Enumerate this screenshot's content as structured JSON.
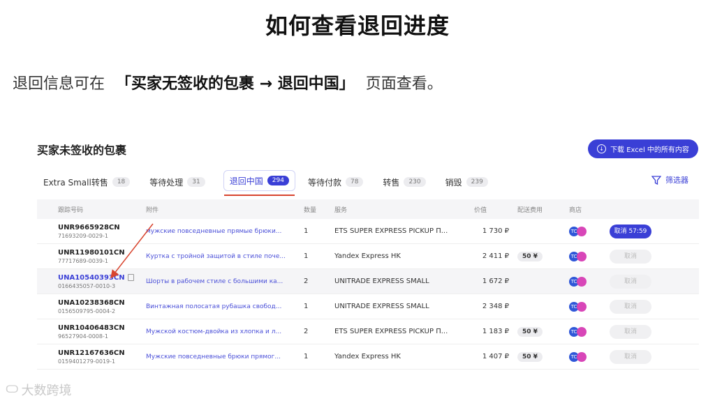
{
  "slide": {
    "title": "如何查看退回进度",
    "intro_prefix": "退回信息可在",
    "intro_path": "「买家无签收的包裹 → 退回中国」",
    "intro_suffix": "页面查看。"
  },
  "panel": {
    "title": "买家未签收的包裹",
    "download_label": "下载 Excel 中的所有内容",
    "filter_label": "筛选器",
    "tabs": [
      {
        "label": "Extra Small转售",
        "count": "18"
      },
      {
        "label": "等待处理",
        "count": "31"
      },
      {
        "label": "退回中国",
        "count": "294"
      },
      {
        "label": "等待付款",
        "count": "78"
      },
      {
        "label": "转售",
        "count": "230"
      },
      {
        "label": "销毁",
        "count": "239"
      }
    ],
    "columns": [
      "跟踪号码",
      "附件",
      "数量",
      "服务",
      "价值",
      "配送费用",
      "商店",
      ""
    ],
    "rows": [
      {
        "tracking": "UNR9665928CN",
        "sub": "71693209-0029-1",
        "item": "мужские повседневные прямые брюки...",
        "qty": "1",
        "service": "ETS SUPER EXPRESS PICKUP П...",
        "value": "1 730 ₽",
        "fee": "",
        "action": "取消 57:59"
      },
      {
        "tracking": "UNR11980101CN",
        "sub": "77717689-0039-1",
        "item": "Куртка с тройной защитой в стиле поче...",
        "qty": "1",
        "service": "Yandex Express HK",
        "value": "2 411 ₽",
        "fee": "50 ¥",
        "action": "取消"
      },
      {
        "tracking": "UNA10540393CN",
        "sub": "0166435057-0010-3",
        "item": "Шорты в рабочем стиле с большими ка...",
        "qty": "2",
        "service": "UNITRADE EXPRESS SMALL",
        "value": "1 672 ₽",
        "fee": "",
        "action": "取消"
      },
      {
        "tracking": "UNA10238368CN",
        "sub": "0156509795-0004-2",
        "item": "Винтажная полосатая рубашка свобод...",
        "qty": "1",
        "service": "UNITRADE EXPRESS SMALL",
        "value": "2 348 ₽",
        "fee": "",
        "action": "取消"
      },
      {
        "tracking": "UNR10406483CN",
        "sub": "96527904-0008-1",
        "item": "Мужской костюм-двойка из хлопка и л...",
        "qty": "2",
        "service": "ETS SUPER EXPRESS PICKUP П...",
        "value": "1 183 ₽",
        "fee": "50 ¥",
        "action": "取消"
      },
      {
        "tracking": "UNR12167636CN",
        "sub": "0159401279-0019-1",
        "item": "Мужские повседневные брюки прямог...",
        "qty": "1",
        "service": "Yandex Express HK",
        "value": "1 407 ₽",
        "fee": "50 ¥",
        "action": "取消"
      }
    ],
    "store_badge": "TC"
  },
  "watermark": "大数跨境",
  "colors": {
    "accent": "#3a3fd6",
    "arrow": "#d8442e"
  }
}
